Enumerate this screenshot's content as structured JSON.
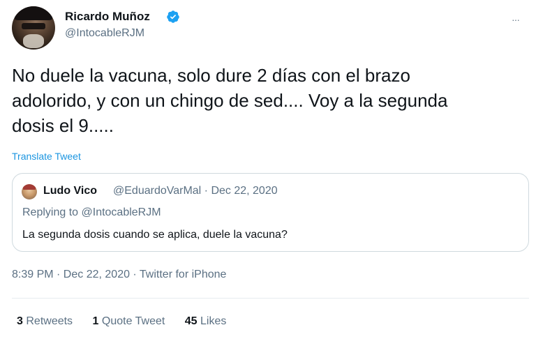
{
  "tweet": {
    "author": {
      "name": "Ricardo Muñoz",
      "handle": "@IntocableRJM",
      "verified": true
    },
    "more_icon": "···",
    "text_lines": [
      "No duele la vacuna, solo dure 2 días con el brazo",
      "adolorido, y con un chingo de sed.... Voy a la segunda",
      "dosis el 9....."
    ],
    "translate_label": "Translate Tweet",
    "quoted": {
      "name": "Ludo Vico",
      "handle_date": "@EduardoVarMal · Dec 22, 2020",
      "replying_prefix": "Replying to ",
      "replying_to": "@IntocableRJM",
      "text": "La segunda dosis cuando se aplica, duele la vacuna?"
    },
    "meta": "8:39 PM · Dec 22, 2020 · Twitter for iPhone",
    "stats": {
      "retweets_count": "3",
      "retweets_label": "Retweets",
      "quotes_count": "1",
      "quotes_label": "Quote Tweet",
      "likes_count": "45",
      "likes_label": "Likes"
    }
  },
  "colors": {
    "accent": "#1b95e0",
    "secondary_text": "#5b7083",
    "verified": "#1da1f2"
  },
  "icons": {
    "verified": "verified-badge-icon",
    "more": "more-options-icon"
  }
}
